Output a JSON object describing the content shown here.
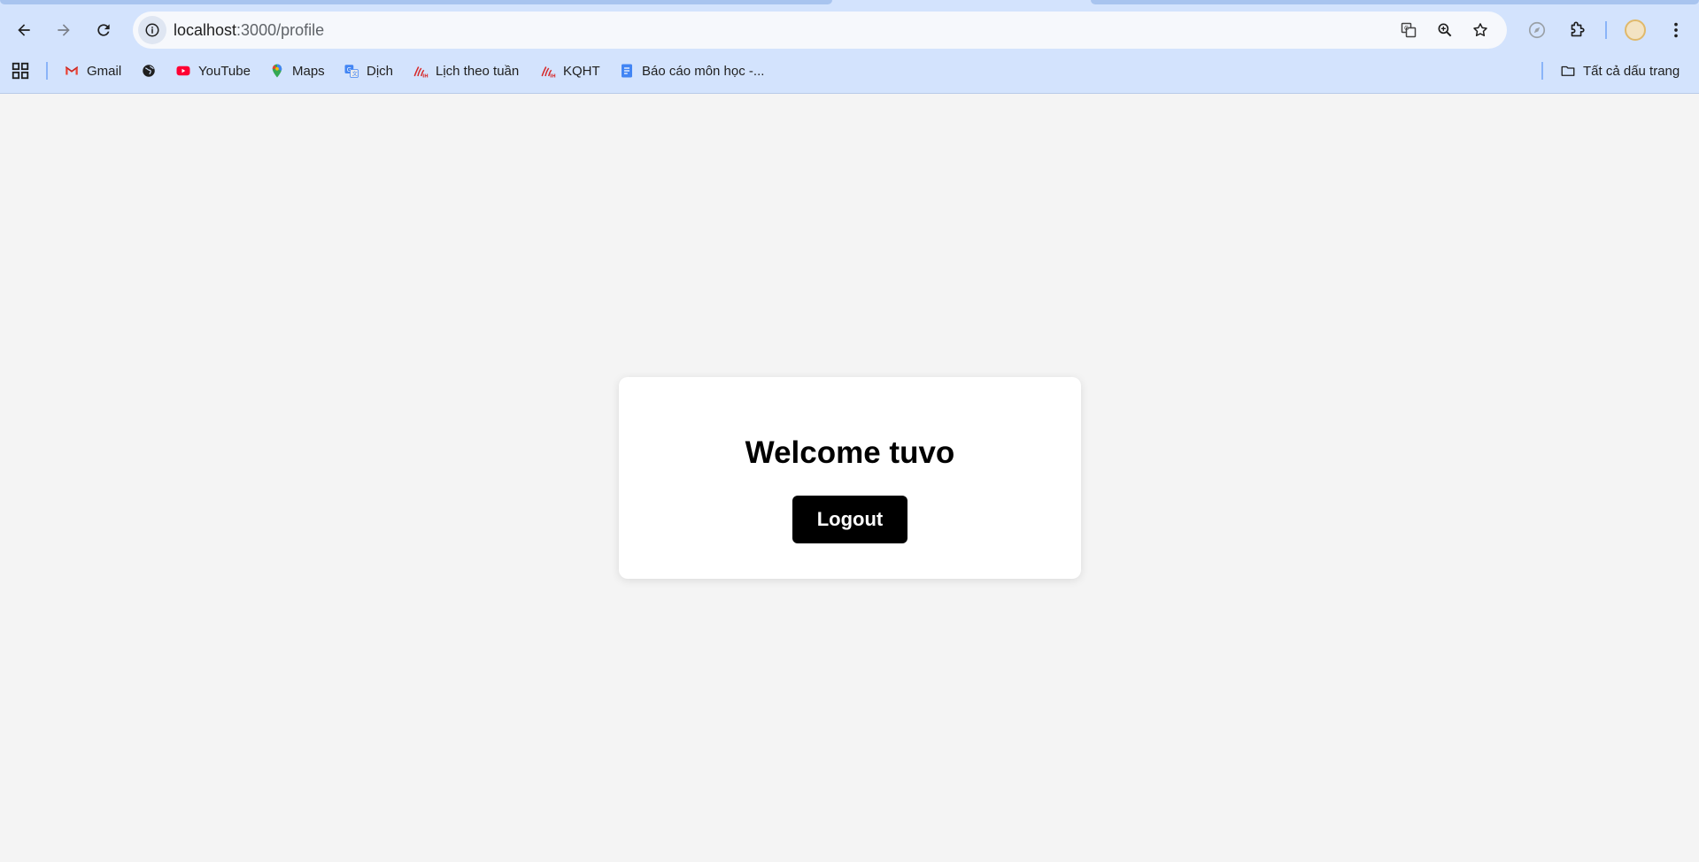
{
  "browser": {
    "address_bar": {
      "host": "localhost",
      "path": ":3000/profile"
    },
    "bookmarks": {
      "items": [
        {
          "label": "Gmail",
          "icon": "gmail-icon"
        },
        {
          "label": "",
          "icon": "globe-icon"
        },
        {
          "label": "YouTube",
          "icon": "youtube-icon"
        },
        {
          "label": "Maps",
          "icon": "maps-icon"
        },
        {
          "label": "Dịch",
          "icon": "translate-icon"
        },
        {
          "label": "Lịch theo tuần",
          "icon": "school-logo-icon"
        },
        {
          "label": "KQHT",
          "icon": "school-logo-icon"
        },
        {
          "label": "Báo cáo môn học -...",
          "icon": "docs-icon"
        }
      ],
      "all_bookmarks_label": "Tất cả dấu trang"
    },
    "colors": {
      "chrome": "#d3e3fd",
      "omnibox": "#f6f8fc",
      "accent": "#8ab4f8"
    }
  },
  "page": {
    "title": "Welcome tuvo",
    "logout_label": "Logout",
    "colors": {
      "background": "#f4f4f4",
      "card": "#ffffff",
      "button": "#000000",
      "button_text": "#ffffff"
    }
  }
}
